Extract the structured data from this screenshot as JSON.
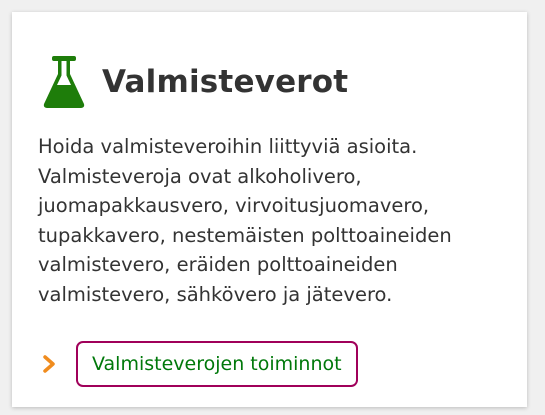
{
  "card": {
    "icon": "flask-icon",
    "title": "Valmisteverot",
    "description": "Hoida valmisteveroihin liittyviä asioita. Valmisteveroja ovat alkoholivero, juomapakkausvero, virvoitusjuomavero, tupakkavero, nestemäisten polttoaineiden valmistevero, eräiden polttoaineiden valmistevero, sähkövero ja jätevero.",
    "action": {
      "icon": "chevron-right-icon",
      "label": "Valmisteverojen toiminnot"
    }
  },
  "colors": {
    "icon_green": "#1e7d0a",
    "title_text": "#333333",
    "link_text": "#00780a",
    "focus_border": "#a0005a",
    "chevron": "#f08c1e",
    "background": "#f0f0f0",
    "card_background": "#ffffff"
  }
}
